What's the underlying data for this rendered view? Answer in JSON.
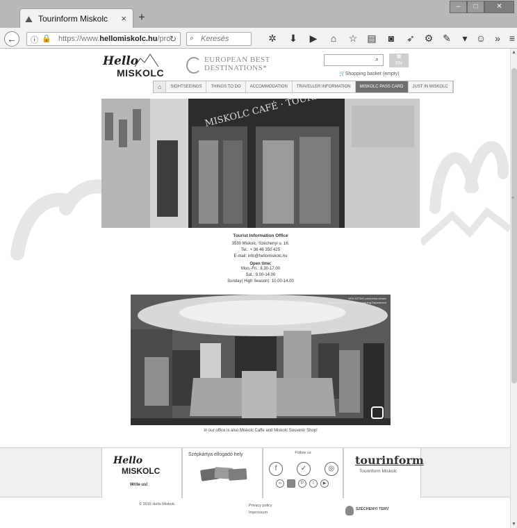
{
  "browser": {
    "tab_title": "Tourinform Miskolc",
    "tab_close": "×",
    "new_tab": "+",
    "url_prefix": "https://www.",
    "url_domain": "hellomiskolc.hu",
    "url_path": "/pro",
    "search_placeholder": "Keresés",
    "window_buttons": {
      "minimize": "–",
      "maximize": "□",
      "close": "✕"
    }
  },
  "site": {
    "logo_hello": "Hello",
    "logo_miskolc": "MISKOLC",
    "award_line1": "EUROPEAN BEST",
    "award_line2": "DESTINATIONS*",
    "basket": "Shopping basket (empty)",
    "lang": "EN",
    "menu": [
      {
        "label": "SIGHTSEEINGS"
      },
      {
        "label": "THINGS TO DO"
      },
      {
        "label": "ACCOMMODATION"
      },
      {
        "label": "TRAVELLER INFORMATION"
      },
      {
        "label": "MISKOLC PASS CARD",
        "active": true
      },
      {
        "label": "JUST IN MISKOLC"
      }
    ]
  },
  "office": {
    "title": "Tourist Information Office",
    "address": "3530 Miskolc, Széchenyi u. 16.",
    "tel": "Tel.: + 36 46 350 425",
    "email": "E-mail: info@hellomiskolc.hu",
    "open_title": "Open time:",
    "hours1": "Mon.-Fri.: 8.30-17.00",
    "hours2": "Sat.: 9.00-14.00",
    "hours3": "Sunday( High Season): 10.00-14.00",
    "sign": "MISKOLC CAFÉ · TOURINFORM",
    "pano_credit1": "MTA SZTAKI panoráma viewer",
    "pano_credit2": "created by: MTA SZTAKI eLearning Department",
    "caption": "In our office is also Miskolc Caffe and Miskolc Souvenir Shop!"
  },
  "footer": {
    "write_us": "Write us!",
    "szep_label": "Szépkártya elfogadó hely",
    "follow_us": "Follow us",
    "tourinform_logo": "tourinform",
    "tourinform_sub": "Tourinform Miskolc",
    "copyright": "© 2015 Hello Miskolc",
    "privacy": "Privacy policy",
    "impressum": "Impressum",
    "szechenyi": "SZÉCHENYI TERV"
  }
}
